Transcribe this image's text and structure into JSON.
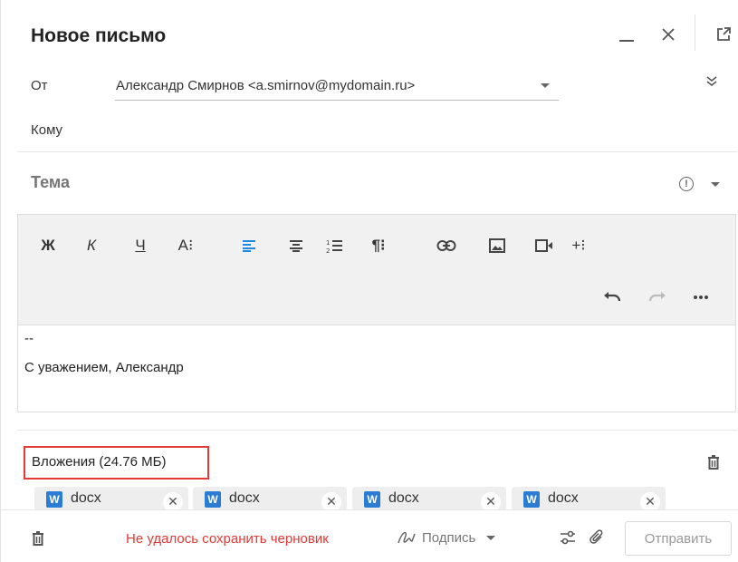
{
  "window": {
    "title": "Новое письмо"
  },
  "from": {
    "label": "От",
    "value": "Александр Смирнов <a.smirnov@mydomain.ru>"
  },
  "to": {
    "label": "Кому"
  },
  "subject": {
    "placeholder": "Тема"
  },
  "toolbar": {
    "bold": "Ж",
    "italic": "К",
    "underline": "Ч",
    "font_size": "A⁝"
  },
  "body": {
    "line1": "--",
    "line2": "С уважением, Александр"
  },
  "attachments": {
    "label": "Вложения (24.76 МБ)",
    "files": [
      {
        "icon": "W",
        "name": "docx"
      },
      {
        "icon": "W",
        "name": "docx"
      },
      {
        "icon": "W",
        "name": "docx"
      },
      {
        "icon": "W",
        "name": "docx"
      }
    ]
  },
  "footer": {
    "error": "Не удалось сохранить черновик",
    "signature_label": "Подпись",
    "send_label": "Отправить"
  },
  "colors": {
    "accent": "#1e88e5",
    "error": "#e53935",
    "word": "#2b7cd3"
  }
}
